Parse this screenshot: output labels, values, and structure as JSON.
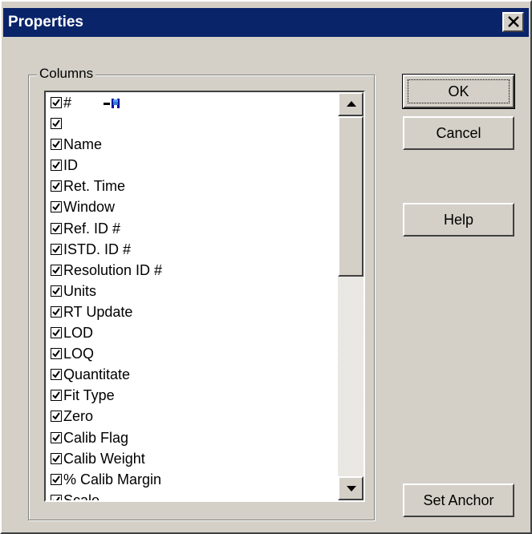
{
  "window": {
    "title": "Properties",
    "close_icon": "close-x-icon"
  },
  "group": {
    "label": "Columns"
  },
  "columns": [
    {
      "label": "#",
      "checked": true,
      "anchor_icon": "anchor-marker-icon"
    },
    {
      "label": "",
      "checked": true
    },
    {
      "label": "Name",
      "checked": true
    },
    {
      "label": "ID",
      "checked": true
    },
    {
      "label": "Ret. Time",
      "checked": true
    },
    {
      "label": "Window",
      "checked": true
    },
    {
      "label": "Ref. ID #",
      "checked": true
    },
    {
      "label": "ISTD. ID #",
      "checked": true
    },
    {
      "label": "Resolution ID #",
      "checked": true
    },
    {
      "label": "Units",
      "checked": true
    },
    {
      "label": "RT Update",
      "checked": true
    },
    {
      "label": "LOD",
      "checked": true
    },
    {
      "label": "LOQ",
      "checked": true
    },
    {
      "label": "Quantitate",
      "checked": true
    },
    {
      "label": "Fit Type",
      "checked": true
    },
    {
      "label": "Zero",
      "checked": true
    },
    {
      "label": "Calib Flag",
      "checked": true
    },
    {
      "label": "Calib Weight",
      "checked": true
    },
    {
      "label": "% Calib Margin",
      "checked": true
    },
    {
      "label": "Scale",
      "checked": true
    }
  ],
  "buttons": {
    "ok": "OK",
    "cancel": "Cancel",
    "help": "Help",
    "set_anchor": "Set Anchor"
  },
  "colors": {
    "titlebar": "#0a246a",
    "face": "#d4d0c8"
  }
}
